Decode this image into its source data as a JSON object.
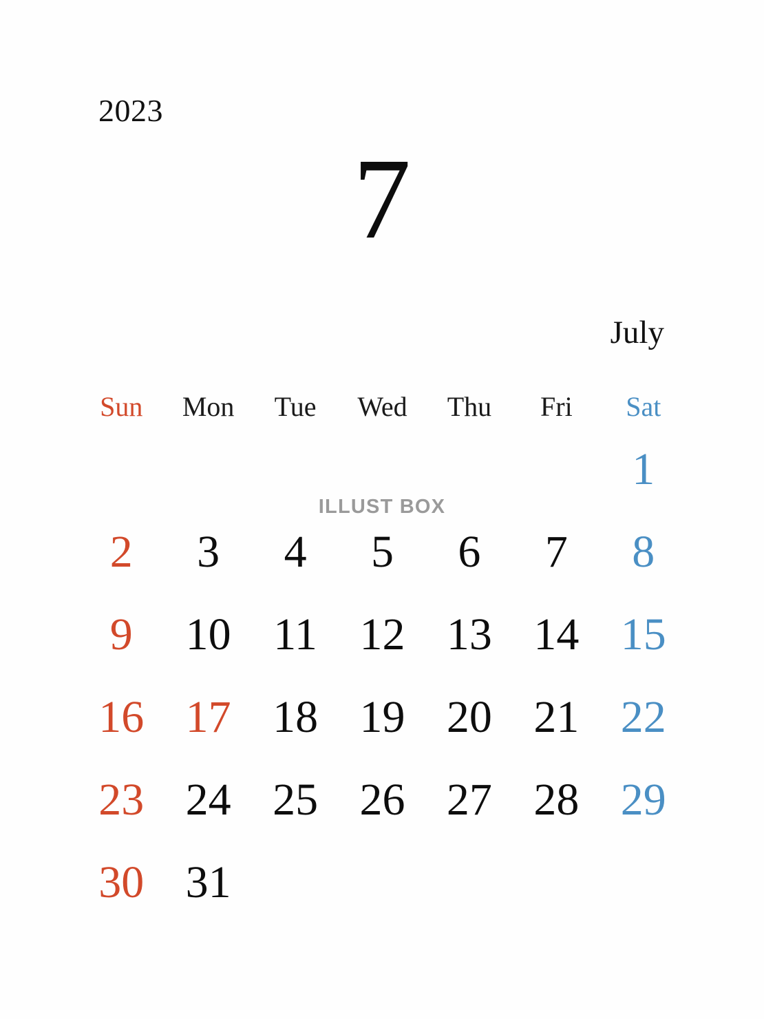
{
  "calendar": {
    "year": "2023",
    "month_number": "7",
    "month_name": "July",
    "watermark": "ILLUST BOX",
    "colors": {
      "sunday_red": "#d2492a",
      "saturday_blue": "#4a8fc4",
      "weekday_black": "#0d0d0d",
      "watermark_gray": "#9a9a9a",
      "background": "#fefefe"
    },
    "day_headers": [
      {
        "label": "Sun",
        "tone": "sun"
      },
      {
        "label": "Mon",
        "tone": "weekday"
      },
      {
        "label": "Tue",
        "tone": "weekday"
      },
      {
        "label": "Wed",
        "tone": "weekday"
      },
      {
        "label": "Thu",
        "tone": "weekday"
      },
      {
        "label": "Fri",
        "tone": "weekday"
      },
      {
        "label": "Sat",
        "tone": "sat"
      }
    ],
    "weeks": [
      [
        {
          "day": "",
          "tone": "empty"
        },
        {
          "day": "",
          "tone": "empty"
        },
        {
          "day": "",
          "tone": "empty"
        },
        {
          "day": "",
          "tone": "empty"
        },
        {
          "day": "",
          "tone": "empty"
        },
        {
          "day": "",
          "tone": "empty"
        },
        {
          "day": "1",
          "tone": "blue"
        }
      ],
      [
        {
          "day": "2",
          "tone": "red"
        },
        {
          "day": "3",
          "tone": "black"
        },
        {
          "day": "4",
          "tone": "black"
        },
        {
          "day": "5",
          "tone": "black"
        },
        {
          "day": "6",
          "tone": "black"
        },
        {
          "day": "7",
          "tone": "black"
        },
        {
          "day": "8",
          "tone": "blue"
        }
      ],
      [
        {
          "day": "9",
          "tone": "red"
        },
        {
          "day": "10",
          "tone": "black"
        },
        {
          "day": "11",
          "tone": "black"
        },
        {
          "day": "12",
          "tone": "black"
        },
        {
          "day": "13",
          "tone": "black"
        },
        {
          "day": "14",
          "tone": "black"
        },
        {
          "day": "15",
          "tone": "blue"
        }
      ],
      [
        {
          "day": "16",
          "tone": "red"
        },
        {
          "day": "17",
          "tone": "red"
        },
        {
          "day": "18",
          "tone": "black"
        },
        {
          "day": "19",
          "tone": "black"
        },
        {
          "day": "20",
          "tone": "black"
        },
        {
          "day": "21",
          "tone": "black"
        },
        {
          "day": "22",
          "tone": "blue"
        }
      ],
      [
        {
          "day": "23",
          "tone": "red"
        },
        {
          "day": "24",
          "tone": "black"
        },
        {
          "day": "25",
          "tone": "black"
        },
        {
          "day": "26",
          "tone": "black"
        },
        {
          "day": "27",
          "tone": "black"
        },
        {
          "day": "28",
          "tone": "black"
        },
        {
          "day": "29",
          "tone": "blue"
        }
      ],
      [
        {
          "day": "30",
          "tone": "red"
        },
        {
          "day": "31",
          "tone": "black"
        },
        {
          "day": "",
          "tone": "empty"
        },
        {
          "day": "",
          "tone": "empty"
        },
        {
          "day": "",
          "tone": "empty"
        },
        {
          "day": "",
          "tone": "empty"
        },
        {
          "day": "",
          "tone": "empty"
        }
      ]
    ]
  }
}
